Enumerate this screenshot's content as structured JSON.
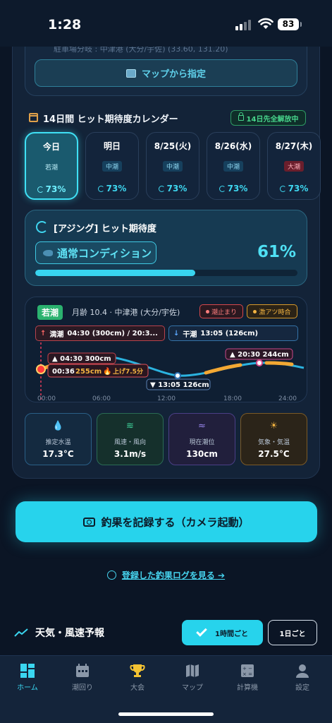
{
  "status": {
    "time": "1:28",
    "battery": "83"
  },
  "map": {
    "top_text": "駐車場分岐 : 中津港 (大分/宇佐) (33.60, 131.20)",
    "button_label": "マップから指定"
  },
  "calendar": {
    "title": "14日間 ヒット期待度カレンダー",
    "unlock_label": "14日先全解放中",
    "days": [
      {
        "label": "今日",
        "tide": "若潮",
        "pct": "73%"
      },
      {
        "label": "明日",
        "tide": "中潮",
        "pct": "73%"
      },
      {
        "label": "8/25(火)",
        "tide": "中潮",
        "pct": "73%"
      },
      {
        "label": "8/26(水)",
        "tide": "中潮",
        "pct": "73%"
      },
      {
        "label": "8/27(木)",
        "tide": "大潮",
        "pct": "73%"
      }
    ]
  },
  "hit": {
    "title": "[アジング] ヒット期待度",
    "condition": "通常コンディション",
    "pct": "61%",
    "fill_percent": 61
  },
  "tide": {
    "badge": "若潮",
    "moon_info": "月齢 10.4 · 中津港 (大分/宇佐)",
    "stop_label": "潮止まり",
    "hot_label": "激アツ時合",
    "high_label": "満潮",
    "high_value": "04:30 (300cm) / 20:3...",
    "low_label": "干潮",
    "low_value": "13:05 (126cm)",
    "chart": {
      "label_high1": "▲ 04:30 300cm",
      "label_now_time": "00:36",
      "label_now_level": "255cm",
      "label_now_trend": "上げ7.5分",
      "label_low": "▼ 13:05 126cm",
      "label_high2": "▲ 20:30 244cm",
      "ticks": [
        "00:00",
        "06:00",
        "12:00",
        "18:00",
        "24:00"
      ]
    }
  },
  "metrics": [
    {
      "icon": "water-drop-icon",
      "label": "推定水温",
      "value": "17.3°C"
    },
    {
      "icon": "wind-icon",
      "label": "風速・風向",
      "value": "3.1m/s"
    },
    {
      "icon": "waves-icon",
      "label": "現在潮位",
      "value": "130cm"
    },
    {
      "icon": "sun-icon",
      "label": "気象・気温",
      "value": "27.5°C"
    }
  ],
  "record_button": "釣果を記録する（カメラ起動）",
  "log_link": "登録した釣果ログを見る ➔",
  "weather": {
    "title": "天気・風速予報",
    "hourly_label": "1時間ごと",
    "daily_label": "1日ごと"
  },
  "tabs": [
    {
      "label": "ホーム",
      "icon": "home-grid-icon"
    },
    {
      "label": "潮回り",
      "icon": "calendar-icon"
    },
    {
      "label": "大会",
      "icon": "trophy-icon"
    },
    {
      "label": "マップ",
      "icon": "map-icon"
    },
    {
      "label": "計算機",
      "icon": "calculator-icon"
    },
    {
      "label": "設定",
      "icon": "person-icon"
    }
  ],
  "colors": {
    "accent": "#27d3ec",
    "background": "#0b1525",
    "high_tide": "#ff6868",
    "low_tide": "#5ca8ff",
    "hot": "#f3b441"
  }
}
